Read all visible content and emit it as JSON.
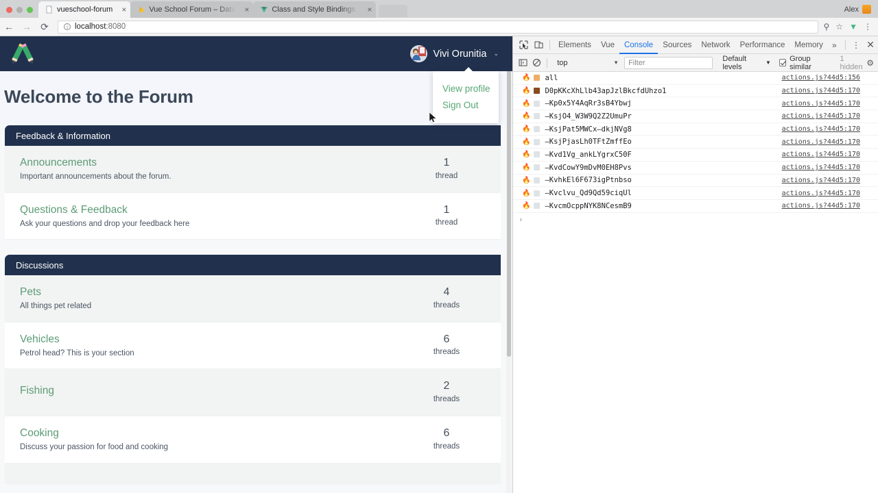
{
  "browser": {
    "window_controls": [
      "close",
      "minimize",
      "maximize"
    ],
    "tabs": [
      {
        "title": "vueschool-forum",
        "favicon": "page-icon",
        "active": true,
        "close_label": "×"
      },
      {
        "title": "Vue School Forum – Database",
        "favicon": "firebase-icon",
        "active": false,
        "close_label": "×"
      },
      {
        "title": "Class and Style Bindings — Vu",
        "favicon": "vue-icon",
        "active": false,
        "close_label": "×"
      }
    ],
    "profile_name": "Alex",
    "nav": {
      "back": "←",
      "forward": "→",
      "reload": "⟳"
    },
    "address": {
      "info_glyph": "ⓘ",
      "host": "localhost",
      "port": ":8080"
    },
    "toolbar_icons": [
      "search-icon",
      "bookmark-star-icon",
      "vue-devtools-icon",
      "chrome-menu-icon"
    ]
  },
  "site": {
    "logo_alt": "vue-school-pencil-logo",
    "user": {
      "name": "Vivi Orunitia",
      "caret": "⌄",
      "menu": [
        {
          "label": "View profile"
        },
        {
          "label": "Sign Out"
        }
      ]
    },
    "page_title": "Welcome to the Forum",
    "categories": [
      {
        "name": "Feedback & Information",
        "forums": [
          {
            "name": "Announcements",
            "description": "Important announcements about the forum.",
            "count": "1",
            "count_label": "thread"
          },
          {
            "name": "Questions & Feedback",
            "description": "Ask your questions and drop your feedback here",
            "count": "1",
            "count_label": "thread"
          }
        ]
      },
      {
        "name": "Discussions",
        "forums": [
          {
            "name": "Pets",
            "description": "All things pet related",
            "count": "4",
            "count_label": "threads"
          },
          {
            "name": "Vehicles",
            "description": "Petrol head? This is your section",
            "count": "6",
            "count_label": "threads"
          },
          {
            "name": "Fishing",
            "description": "",
            "count": "2",
            "count_label": "threads"
          },
          {
            "name": "Cooking",
            "description": "Discuss your passion for food and cooking",
            "count": "6",
            "count_label": "threads"
          }
        ]
      }
    ],
    "colors": {
      "header_navy": "#21314d",
      "link_green": "#5d9b76",
      "page_bg": "#f7f8fa",
      "alt_row": "#f2f4f3"
    }
  },
  "devtools": {
    "tabs": [
      "Elements",
      "Vue",
      "Console",
      "Sources",
      "Network",
      "Performance",
      "Memory"
    ],
    "active_tab": "Console",
    "more_tabs": "»",
    "kebab": "⋮",
    "close": "✕",
    "toolbar": {
      "context": "top",
      "filter_placeholder": "Filter",
      "levels": "Default levels",
      "group_similar": "Group similar",
      "group_similar_checked": true,
      "hidden_message": "1 hidden",
      "gear": "⚙"
    },
    "logs": [
      {
        "icon": "object-orange",
        "text": "all",
        "source": "actions.js?44d5:156"
      },
      {
        "icon": "object-dark",
        "text": "D0pKKcXhLlb43apJzlBkcfdUhzo1",
        "source": "actions.js?44d5:170"
      },
      {
        "icon": "object-grey",
        "text": "–Kp0x5Y4AqRr3sB4Ybwj",
        "source": "actions.js?44d5:170"
      },
      {
        "icon": "object-grey",
        "text": "–KsjO4_W3W9Q2Z2UmuPr",
        "source": "actions.js?44d5:170"
      },
      {
        "icon": "object-grey",
        "text": "–KsjPat5MWCx–dkjNVg8",
        "source": "actions.js?44d5:170"
      },
      {
        "icon": "object-grey",
        "text": "–KsjPjasLh0TFtZmffEo",
        "source": "actions.js?44d5:170"
      },
      {
        "icon": "object-grey",
        "text": "–Kvd1Vg_ankLYgrxC50F",
        "source": "actions.js?44d5:170"
      },
      {
        "icon": "object-grey",
        "text": "–KvdCowY9mDvM0EH8Pvs",
        "source": "actions.js?44d5:170"
      },
      {
        "icon": "object-grey",
        "text": "–KvhkEl6F673igPtnbso",
        "source": "actions.js?44d5:170"
      },
      {
        "icon": "object-grey",
        "text": "–Kvclvu_Qd9Qd59ciqUl",
        "source": "actions.js?44d5:170"
      },
      {
        "icon": "object-grey",
        "text": "–KvcmOcppNYK8NCesmB9",
        "source": "actions.js?44d5:170"
      }
    ],
    "prompt": "›"
  }
}
